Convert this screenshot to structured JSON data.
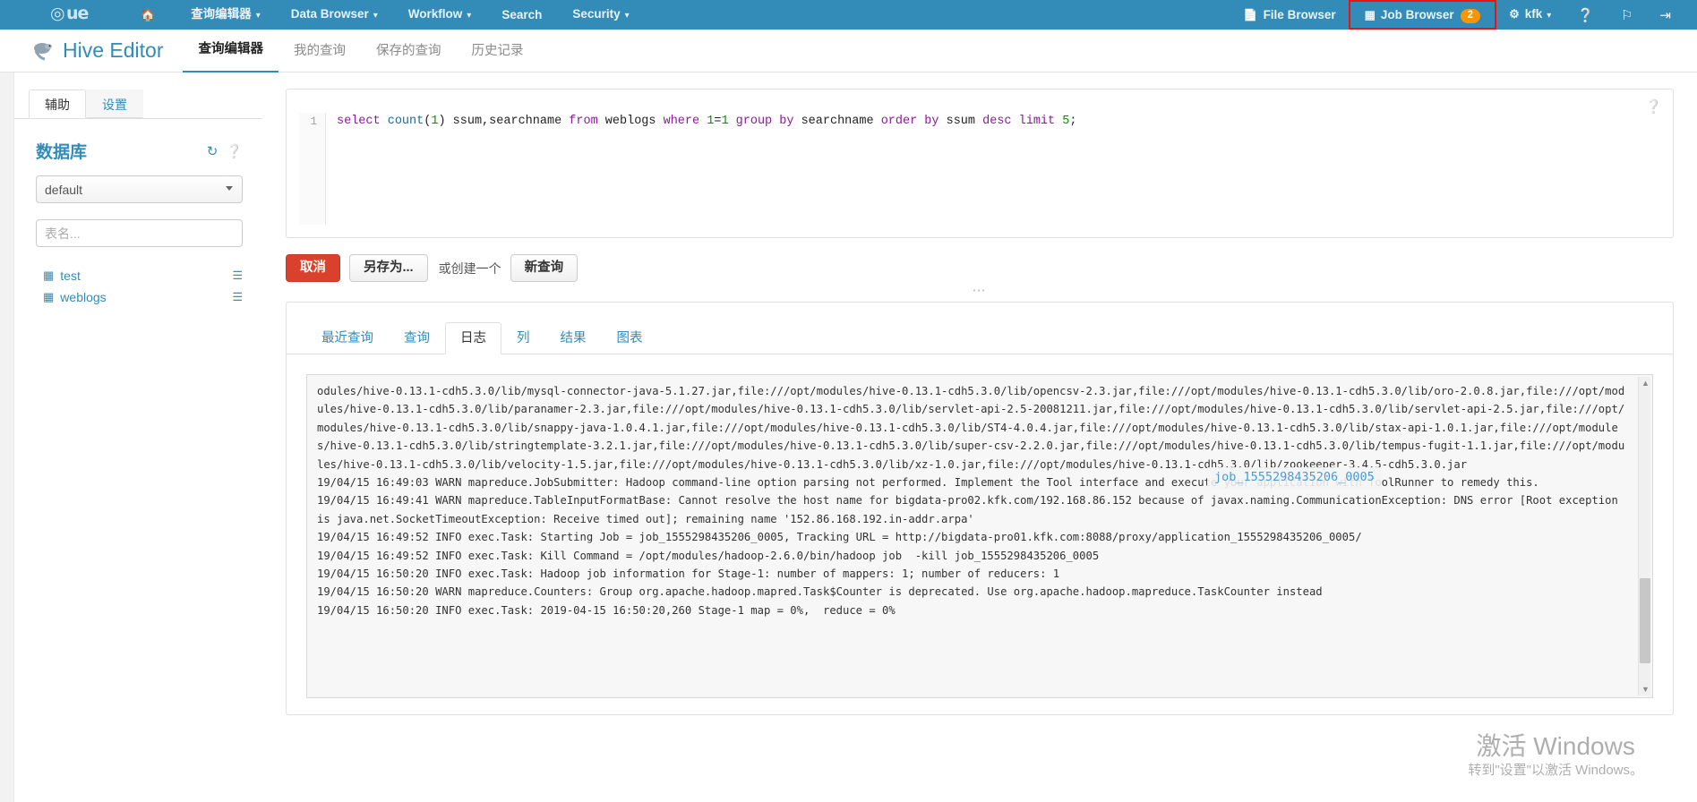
{
  "topnav": {
    "logo": "Hue",
    "left_items": [
      {
        "label": "",
        "icon": "home-icon",
        "caret": false
      },
      {
        "label": "查询编辑器",
        "icon": "",
        "caret": true
      },
      {
        "label": "Data Browser",
        "icon": "",
        "caret": true
      },
      {
        "label": "Workflow",
        "icon": "",
        "caret": true
      },
      {
        "label": "Search",
        "icon": "",
        "caret": false
      },
      {
        "label": "Security",
        "icon": "",
        "caret": true
      }
    ],
    "right_items": [
      {
        "label": "File Browser",
        "icon": "file-icon",
        "caret": false,
        "badge": ""
      },
      {
        "label": "Job Browser",
        "icon": "list-icon",
        "caret": false,
        "badge": "2",
        "highlighted": true
      },
      {
        "label": "kfk",
        "icon": "gear-icon",
        "caret": true,
        "badge": ""
      }
    ],
    "icon_buttons": [
      "help-icon",
      "flag-icon",
      "logout-icon"
    ],
    "badge_color": "#f89406",
    "highlight_color": "#e8140f",
    "bar_color": "#338bb8"
  },
  "subnav": {
    "app_title": "Hive Editor",
    "tabs": [
      {
        "label": "查询编辑器",
        "active": true
      },
      {
        "label": "我的查询",
        "active": false
      },
      {
        "label": "保存的查询",
        "active": false
      },
      {
        "label": "历史记录",
        "active": false
      }
    ]
  },
  "sidebar": {
    "tabs": [
      {
        "label": "辅助",
        "active": true
      },
      {
        "label": "设置",
        "active": false
      }
    ],
    "database_title": "数据库",
    "database_icons": [
      "refresh-icon",
      "help-icon"
    ],
    "database_selected": "default",
    "database_options": [
      "default"
    ],
    "table_filter_placeholder": "表名...",
    "table_filter_value": "",
    "tables": [
      {
        "name": "test"
      },
      {
        "name": "weblogs"
      }
    ]
  },
  "editor": {
    "line_number": "1",
    "query_parts": [
      {
        "t": "select ",
        "c": "kw"
      },
      {
        "t": "count",
        "c": "fn"
      },
      {
        "t": "(",
        "c": "plain"
      },
      {
        "t": "1",
        "c": "num"
      },
      {
        "t": ") ssum,searchname ",
        "c": "plain"
      },
      {
        "t": "from ",
        "c": "kw"
      },
      {
        "t": "weblogs ",
        "c": "plain"
      },
      {
        "t": "where ",
        "c": "kw"
      },
      {
        "t": "1",
        "c": "num"
      },
      {
        "t": "=",
        "c": "plain"
      },
      {
        "t": "1 ",
        "c": "num"
      },
      {
        "t": "group by ",
        "c": "kw"
      },
      {
        "t": "searchname ",
        "c": "plain"
      },
      {
        "t": "order by ",
        "c": "kw"
      },
      {
        "t": "ssum ",
        "c": "plain"
      },
      {
        "t": "desc limit ",
        "c": "kw"
      },
      {
        "t": "5",
        "c": "num"
      },
      {
        "t": ";",
        "c": "plain"
      }
    ],
    "query_plain": "select count(1) ssum,searchname from weblogs where 1=1 group by searchname order by ssum desc limit 5;",
    "buttons": {
      "cancel": "取消",
      "save_as": "另存为...",
      "or_create": "或创建一个",
      "new_query": "新查询"
    }
  },
  "results": {
    "tabs": [
      {
        "label": "最近查询",
        "active": false
      },
      {
        "label": "查询",
        "active": false
      },
      {
        "label": "日志",
        "active": true
      },
      {
        "label": "列",
        "active": false
      },
      {
        "label": "结果",
        "active": false
      },
      {
        "label": "图表",
        "active": false
      }
    ],
    "log_text": "odules/hive-0.13.1-cdh5.3.0/lib/mysql-connector-java-5.1.27.jar,file:///opt/modules/hive-0.13.1-cdh5.3.0/lib/opencsv-2.3.jar,file:///opt/modules/hive-0.13.1-cdh5.3.0/lib/oro-2.0.8.jar,file:///opt/modules/hive-0.13.1-cdh5.3.0/lib/paranamer-2.3.jar,file:///opt/modules/hive-0.13.1-cdh5.3.0/lib/servlet-api-2.5-20081211.jar,file:///opt/modules/hive-0.13.1-cdh5.3.0/lib/servlet-api-2.5.jar,file:///opt/modules/hive-0.13.1-cdh5.3.0/lib/snappy-java-1.0.4.1.jar,file:///opt/modules/hive-0.13.1-cdh5.3.0/lib/ST4-4.0.4.jar,file:///opt/modules/hive-0.13.1-cdh5.3.0/lib/stax-api-1.0.1.jar,file:///opt/modules/hive-0.13.1-cdh5.3.0/lib/stringtemplate-3.2.1.jar,file:///opt/modules/hive-0.13.1-cdh5.3.0/lib/super-csv-2.2.0.jar,file:///opt/modules/hive-0.13.1-cdh5.3.0/lib/tempus-fugit-1.1.jar,file:///opt/modules/hive-0.13.1-cdh5.3.0/lib/velocity-1.5.jar,file:///opt/modules/hive-0.13.1-cdh5.3.0/lib/xz-1.0.jar,file:///opt/modules/hive-0.13.1-cdh5.3.0/lib/zookeeper-3.4.5-cdh5.3.0.jar\n19/04/15 16:49:03 WARN mapreduce.JobSubmitter: Hadoop command-line option parsing not performed. Implement the Tool interface and execute your application with ToolRunner to remedy this.\n19/04/15 16:49:41 WARN mapreduce.TableInputFormatBase: Cannot resolve the host name for bigdata-pro02.kfk.com/192.168.86.152 because of javax.naming.CommunicationException: DNS error [Root exception is java.net.SocketTimeoutException: Receive timed out]; remaining name '152.86.168.192.in-addr.arpa'\n19/04/15 16:49:52 INFO exec.Task: Starting Job = job_1555298435206_0005, Tracking URL = http://bigdata-pro01.kfk.com:8088/proxy/application_1555298435206_0005/\n19/04/15 16:49:52 INFO exec.Task: Kill Command = /opt/modules/hadoop-2.6.0/bin/hadoop job  -kill job_1555298435206_0005\n19/04/15 16:50:20 INFO exec.Task: Hadoop job information for Stage-1: number of mappers: 1; number of reducers: 1\n19/04/15 16:50:20 WARN mapreduce.Counters: Group org.apache.hadoop.mapred.Task$Counter is deprecated. Use org.apache.hadoop.mapreduce.TaskCounter instead\n19/04/15 16:50:20 INFO exec.Task: 2019-04-15 16:50:20,260 Stage-1 map = 0%,  reduce = 0%",
    "job_tooltip": "job_1555298435206_0005"
  },
  "watermark": {
    "line1": "激活 Windows",
    "line2": "转到\"设置\"以激活 Windows。"
  }
}
